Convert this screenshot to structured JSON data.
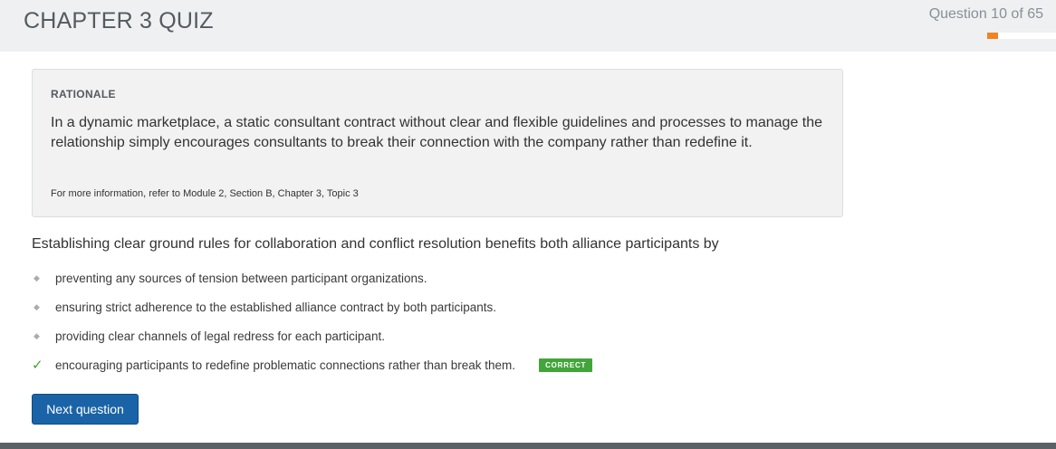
{
  "header": {
    "title": "CHAPTER 3 QUIZ",
    "question_counter": "Question 10 of 65",
    "progress": {
      "current": 10,
      "total": 65,
      "fraction": 0.154
    },
    "progress_color": "#f08322"
  },
  "rationale": {
    "heading": "RATIONALE",
    "text": "In a dynamic marketplace, a static consultant contract without clear and flexible guidelines and processes to manage the relationship simply encourages consultants to break their connection with the company rather than redefine it.",
    "reference": "For more information, refer to Module 2, Section B, Chapter 3, Topic 3"
  },
  "question": {
    "stem": "Establishing clear ground rules for collaboration and conflict resolution benefits both alliance participants by",
    "answers": [
      {
        "text": "preventing any sources of tension between participant organizations.",
        "marker": "diamond-icon",
        "correct": false
      },
      {
        "text": "ensuring strict adherence to the established alliance contract by both participants.",
        "marker": "diamond-icon",
        "correct": false
      },
      {
        "text": "providing clear channels of legal redress for each participant.",
        "marker": "diamond-icon",
        "correct": false
      },
      {
        "text": "encouraging participants to redefine problematic connections rather than break them.",
        "marker": "checkmark-icon",
        "correct": true,
        "badge": "CORRECT"
      }
    ]
  },
  "actions": {
    "next_label": "Next question",
    "button_color": "#1a63a6"
  },
  "colors": {
    "correct_green": "#42a53a",
    "header_bg": "#eef0f2",
    "footer_bg": "#5c6166"
  }
}
